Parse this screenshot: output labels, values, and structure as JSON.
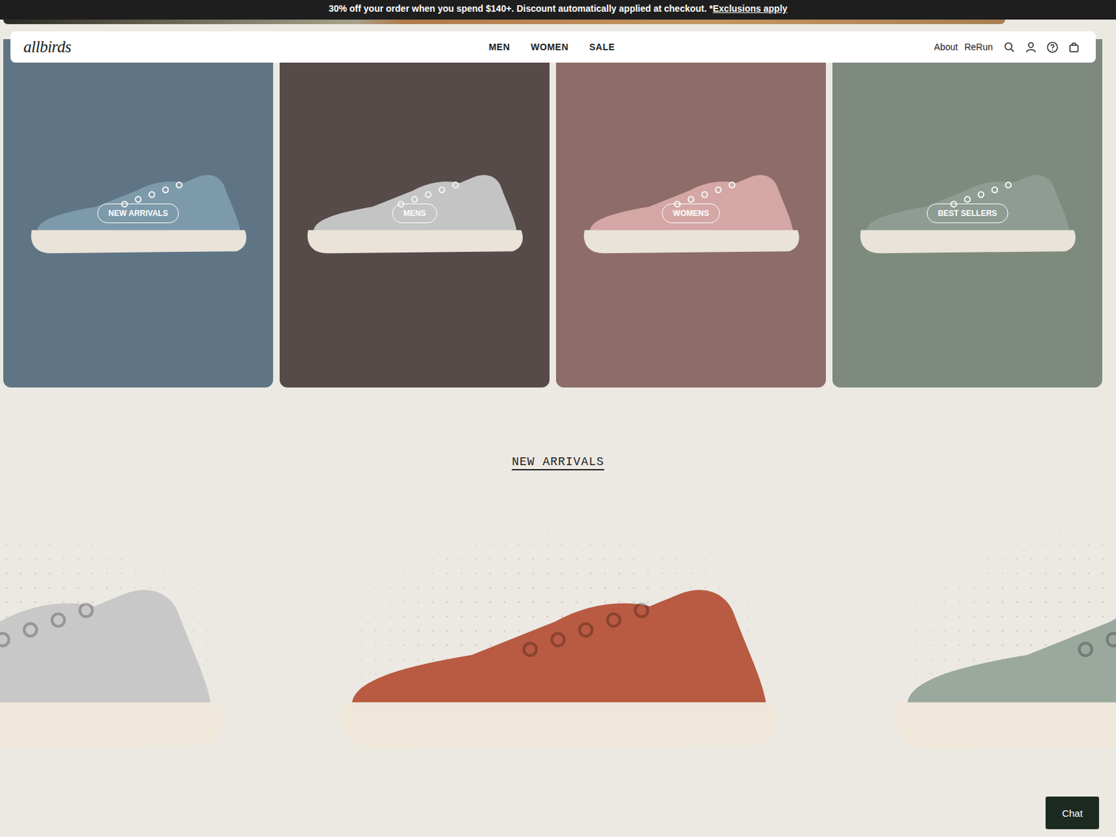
{
  "promo": {
    "text": "30% off your order when you spend $140+. Discount automatically applied at checkout. *",
    "link": "Exclusions apply"
  },
  "nav": {
    "logo": "allbirds",
    "links": [
      "MEN",
      "WOMEN",
      "SALE"
    ],
    "utility": [
      "About",
      "ReRun"
    ]
  },
  "categories": [
    {
      "label": "NEW ARRIVALS",
      "color": "#5f7585",
      "shoe_color": "#7d9aab"
    },
    {
      "label": "MENS",
      "color": "#564b49",
      "shoe_color": "#c4c4c4"
    },
    {
      "label": "WOMENS",
      "color": "#8e6c68",
      "shoe_color": "#d4a7a5"
    },
    {
      "label": "BEST SELLERS",
      "color": "#7e8a7e",
      "shoe_color": "#8f9c93"
    }
  ],
  "section": {
    "title": "NEW ARRIVALS"
  },
  "carousel": [
    {
      "color": "#c8c8c8"
    },
    {
      "color": "#b95a42"
    },
    {
      "color": "#9aa89e"
    }
  ],
  "chat": {
    "label": "Chat"
  }
}
